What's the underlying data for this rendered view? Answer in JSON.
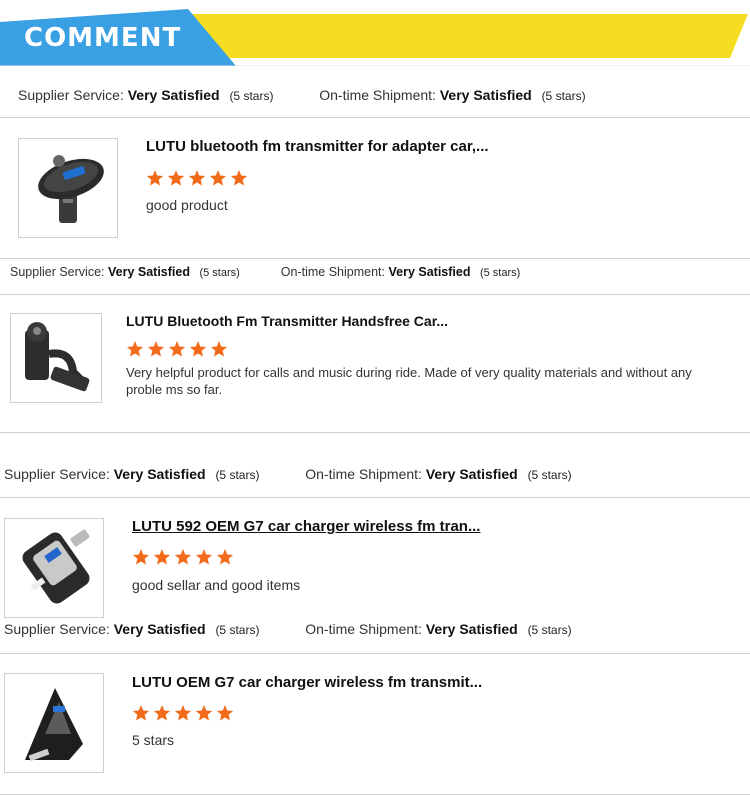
{
  "header": {
    "title": "COMMENT",
    "blue": "#3aa0e4",
    "yellow": "#f7dd21"
  },
  "star_color": "#f26b1a",
  "reviews": [
    {
      "supplier_label": "Supplier Service:",
      "supplier_value": "Very Satisfied",
      "supplier_note": "(5 stars)",
      "shipment_label": "On-time Shipment:",
      "shipment_value": "Very Satisfied",
      "shipment_note": "(5 stars)",
      "product_title": "LUTU bluetooth fm transmitter for adapter car,...",
      "rating": 5,
      "comment": "good product",
      "thumb_icon": "fm-transmitter-round-icon"
    },
    {
      "supplier_label": "Supplier Service:",
      "supplier_value": "Very Satisfied",
      "supplier_note": "(5 stars)",
      "shipment_label": "On-time Shipment:",
      "shipment_value": "Very Satisfied",
      "shipment_note": "(5 stars)",
      "product_title": "LUTU Bluetooth Fm Transmitter Handsfree Car...",
      "rating": 5,
      "comment": "Very helpful product for calls and music during ride. Made of very quality materials and without any proble ms so far.",
      "thumb_icon": "fm-transmitter-gooseneck-icon"
    },
    {
      "supplier_label": "Supplier Service:",
      "supplier_value": "Very Satisfied",
      "supplier_note": "(5 stars)",
      "shipment_label": "On-time Shipment:",
      "shipment_value": "Very Satisfied",
      "shipment_note": "(5 stars)",
      "product_title": "LUTU 592 OEM G7 car charger wireless fm tran...",
      "rating": 5,
      "comment": "good sellar and good items",
      "thumb_icon": "car-charger-g7-icon"
    },
    {
      "supplier_label": "Supplier Service:",
      "supplier_value": "Very Satisfied",
      "supplier_note": "(5 stars)",
      "shipment_label": "On-time Shipment:",
      "shipment_value": "Very Satisfied",
      "shipment_note": "(5 stars)",
      "product_title": "LUTU OEM G7 car charger wireless fm transmit...",
      "rating": 5,
      "comment": "5 stars",
      "thumb_icon": "car-charger-g7-black-icon"
    }
  ]
}
